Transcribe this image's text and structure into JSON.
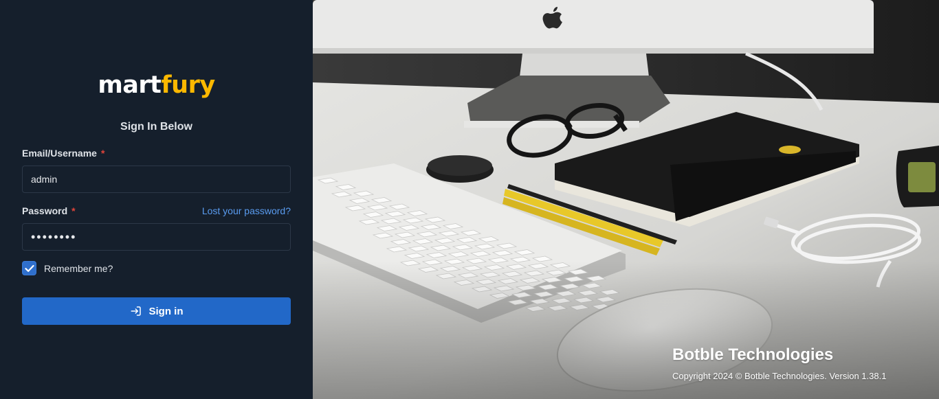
{
  "logo": {
    "part1": "mart",
    "part2": "fury"
  },
  "form": {
    "heading": "Sign In Below",
    "email_label": "Email/Username",
    "required_mark": "*",
    "email_value": "admin",
    "password_label": "Password",
    "password_value": "••••••••",
    "forgot_link": "Lost your password?",
    "remember_label": "Remember me?",
    "remember_checked": true,
    "sign_in_label": "Sign in"
  },
  "footer": {
    "company": "Botble Technologies",
    "copyright": "Copyright 2024 © Botble Technologies. Version 1.38.1"
  },
  "colors": {
    "panel_bg": "#151f2c",
    "accent": "#fcb800",
    "primary_button": "#2268c8",
    "link": "#5a9cf0",
    "required": "#e0443a"
  },
  "icons": [
    "checkmark-icon",
    "sign-in-icon",
    "apple-logo-icon"
  ]
}
